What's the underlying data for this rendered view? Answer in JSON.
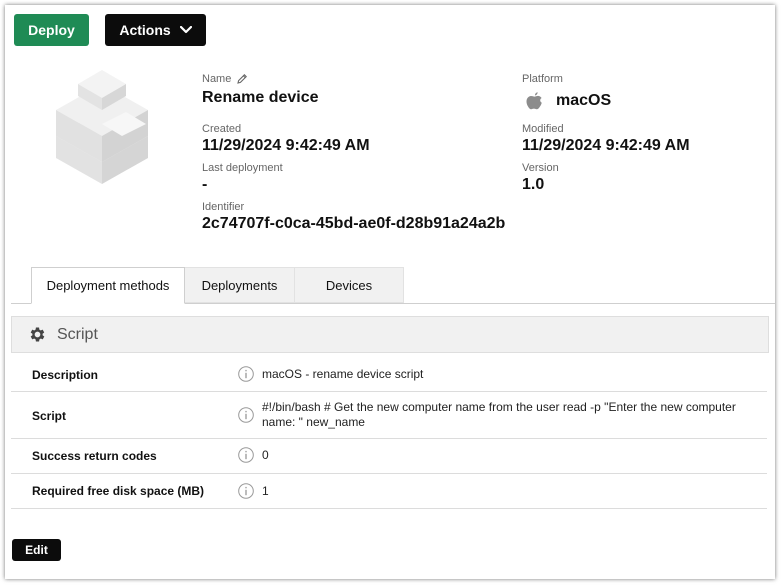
{
  "toolbar": {
    "deploy_label": "Deploy",
    "actions_label": "Actions"
  },
  "details": {
    "name_label": "Name",
    "name_value": "Rename device",
    "platform_label": "Platform",
    "platform_value": "macOS",
    "created_label": "Created",
    "created_value": "11/29/2024 9:42:49 AM",
    "modified_label": "Modified",
    "modified_value": "11/29/2024 9:42:49 AM",
    "last_deployment_label": "Last deployment",
    "last_deployment_value": "-",
    "version_label": "Version",
    "version_value": "1.0",
    "identifier_label": "Identifier",
    "identifier_value": "2c74707f-c0ca-45bd-ae0f-d28b91a24a2b"
  },
  "tabs": [
    {
      "label": "Deployment methods",
      "active": true
    },
    {
      "label": "Deployments",
      "active": false
    },
    {
      "label": "Devices",
      "active": false
    }
  ],
  "section": {
    "title": "Script",
    "rows": [
      {
        "label": "Description",
        "value": "macOS - rename device script"
      },
      {
        "label": "Script",
        "value": "#!/bin/bash # Get the new computer name from the user read -p \"Enter the new computer name: \" new_name"
      },
      {
        "label": "Success return codes",
        "value": "0"
      },
      {
        "label": "Required free disk space (MB)",
        "value": "1"
      }
    ]
  },
  "footer": {
    "edit_label": "Edit"
  },
  "icons": {
    "edit_name": "pencil-icon",
    "platform": "apple-icon",
    "section": "gear-icon",
    "info": "info-icon",
    "actions_dropdown": "chevron-down-icon",
    "package": "package-cube-icon"
  },
  "colors": {
    "deploy": "#1f8b55",
    "dark_button": "#0c0c0c"
  }
}
